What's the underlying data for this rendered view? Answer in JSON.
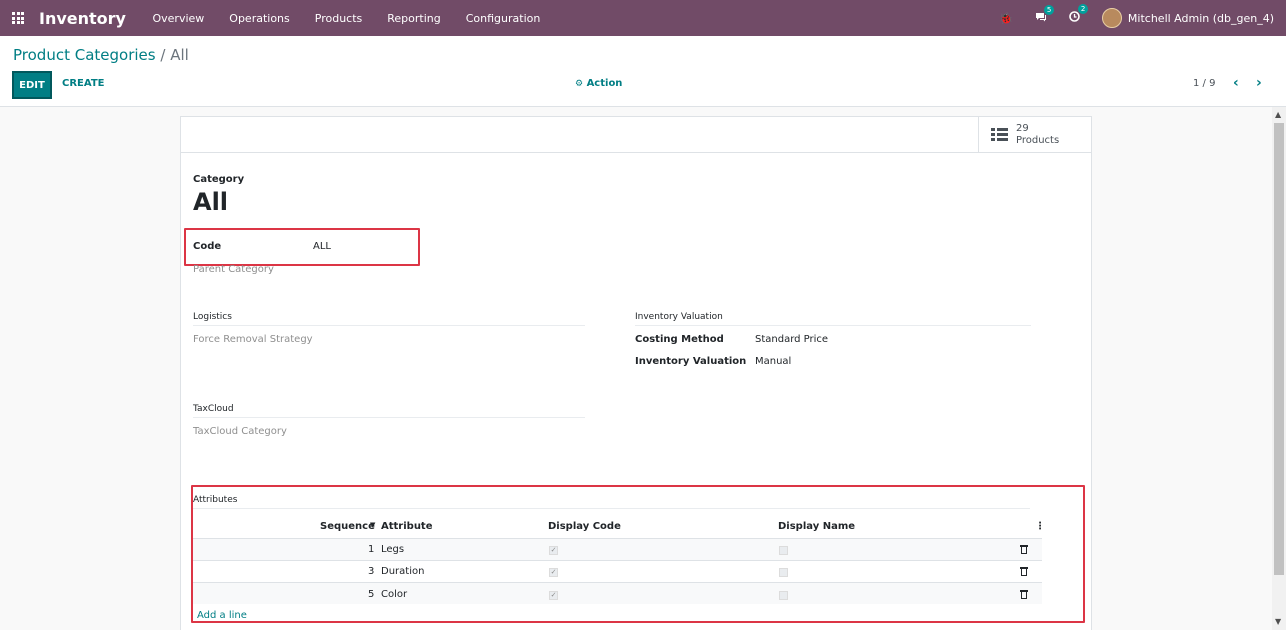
{
  "navbar": {
    "app_name": "Inventory",
    "menu": [
      "Overview",
      "Operations",
      "Products",
      "Reporting",
      "Configuration"
    ],
    "bug_icon": "🐞",
    "chat_count": "5",
    "activity_count": "2",
    "user": "Mitchell Admin (db_gen_4)"
  },
  "breadcrumb": {
    "parent": "Product Categories",
    "separator": "/",
    "current": "All"
  },
  "toolbar": {
    "edit_label": "EDIT",
    "create_label": "CREATE",
    "action_label": "Action",
    "pager": "1 / 9"
  },
  "smart_button": {
    "count": "29",
    "label": "Products"
  },
  "form": {
    "category_label": "Category",
    "category_name": "All",
    "code_label": "Code",
    "code_value": "ALL",
    "parent_label": "Parent Category",
    "logistics": {
      "title": "Logistics",
      "removal_label": "Force Removal Strategy"
    },
    "valuation": {
      "title": "Inventory Valuation",
      "costing_label": "Costing Method",
      "costing_value": "Standard Price",
      "valuation_label": "Inventory Valuation",
      "valuation_value": "Manual"
    },
    "taxcloud": {
      "title": "TaxCloud",
      "category_label": "TaxCloud Category"
    }
  },
  "attributes": {
    "title": "Attributes",
    "headers": {
      "sequence": "Sequence",
      "attribute": "Attribute",
      "display_code": "Display Code",
      "display_name": "Display Name"
    },
    "rows": [
      {
        "sequence": "1",
        "attribute": "Legs",
        "display_code": true,
        "display_name": false
      },
      {
        "sequence": "3",
        "attribute": "Duration",
        "display_code": true,
        "display_name": false
      },
      {
        "sequence": "5",
        "attribute": "Color",
        "display_code": true,
        "display_name": false
      }
    ],
    "add_line": "Add a line"
  },
  "colors": {
    "navbar": "#714b67",
    "primary": "#017e84",
    "highlight": "#dc3545"
  }
}
